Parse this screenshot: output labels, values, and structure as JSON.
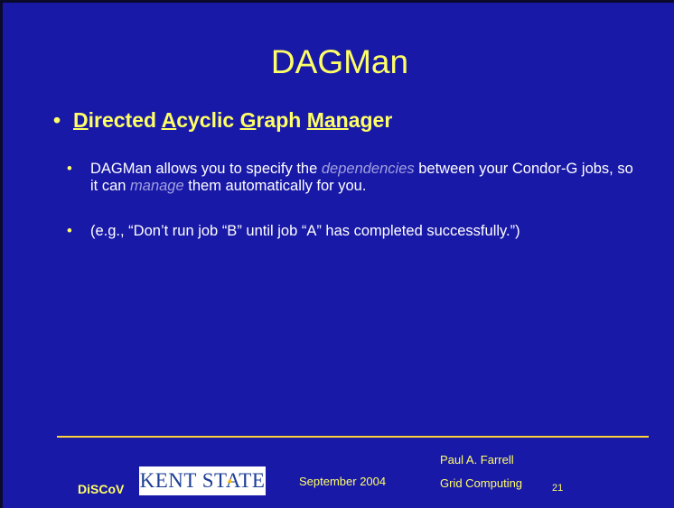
{
  "slide": {
    "title": "DAGMan",
    "heading": {
      "bullet": "•",
      "parts": [
        {
          "text": "D",
          "underline": true
        },
        {
          "text": "irected ",
          "underline": false
        },
        {
          "text": "A",
          "underline": true
        },
        {
          "text": "cyclic ",
          "underline": false
        },
        {
          "text": "G",
          "underline": true
        },
        {
          "text": "raph ",
          "underline": false
        },
        {
          "text": "Man",
          "underline": true
        },
        {
          "text": "ager",
          "underline": false
        }
      ]
    },
    "bullets": [
      {
        "bullet": "•",
        "t1": "DAGMan allows you to specify the ",
        "em1": "dependencies",
        "t2": " between your Condor-G jobs, so it can ",
        "em2": "manage",
        "t3": " them automatically for you."
      },
      {
        "bullet": "•",
        "t1": "(e.g., “Don’t run job “B” until job “A” has completed successfully.”)"
      }
    ]
  },
  "footer": {
    "discov": "DiSCoV",
    "kent_logo_text": "KENT STATE",
    "date": "September 2004",
    "author": "Paul A. Farrell",
    "course": "Grid Computing",
    "page_number": "21"
  },
  "colors": {
    "background": "#1919a8",
    "title_text": "#ffff66",
    "body_text": "#ffffff",
    "emphasis_text": "#9fa0e0",
    "rule": "#ffd23a"
  }
}
